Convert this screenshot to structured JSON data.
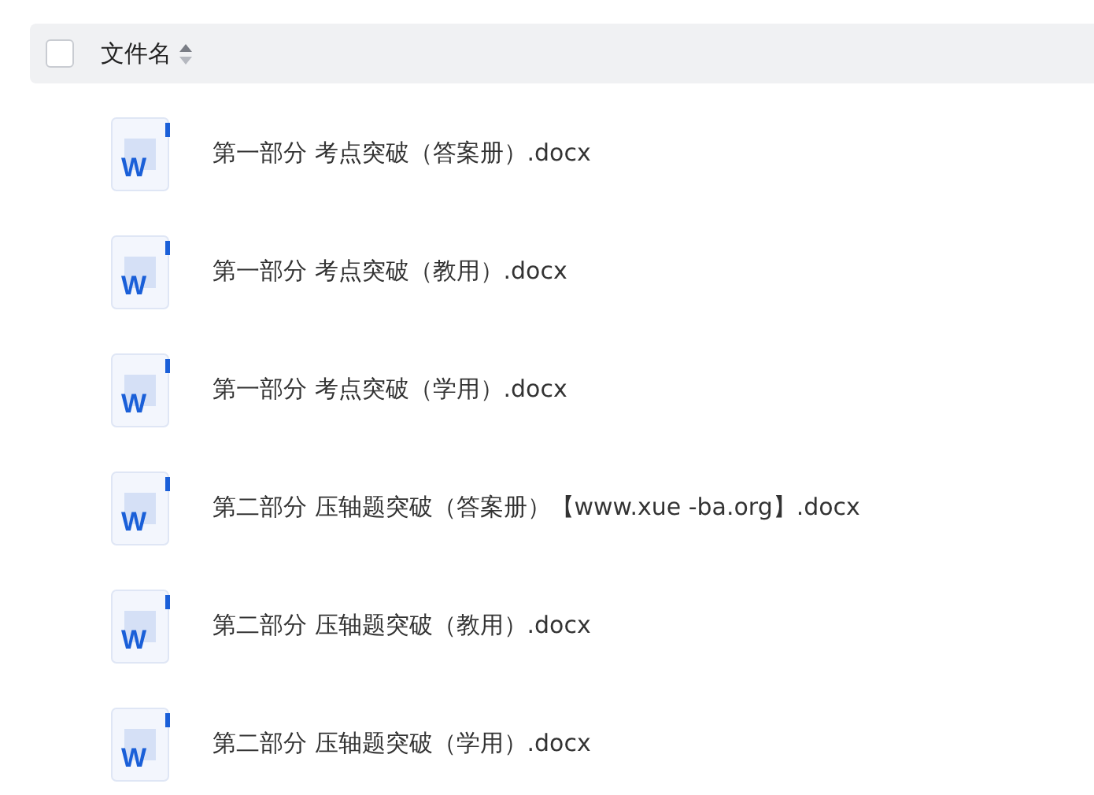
{
  "header": {
    "checked": false,
    "column": "文件名"
  },
  "files": [
    {
      "icon_label": "W",
      "name": "第一部分 考点突破（答案册）.docx"
    },
    {
      "icon_label": "W",
      "name": "第一部分 考点突破（教用）.docx"
    },
    {
      "icon_label": "W",
      "name": "第一部分 考点突破（学用）.docx"
    },
    {
      "icon_label": "W",
      "name": "第二部分 压轴题突破（答案册）【www.xue -ba.org】.docx"
    },
    {
      "icon_label": "W",
      "name": "第二部分 压轴题突破（教用）.docx"
    },
    {
      "icon_label": "W",
      "name": "第二部分 压轴题突破（学用）.docx"
    }
  ]
}
